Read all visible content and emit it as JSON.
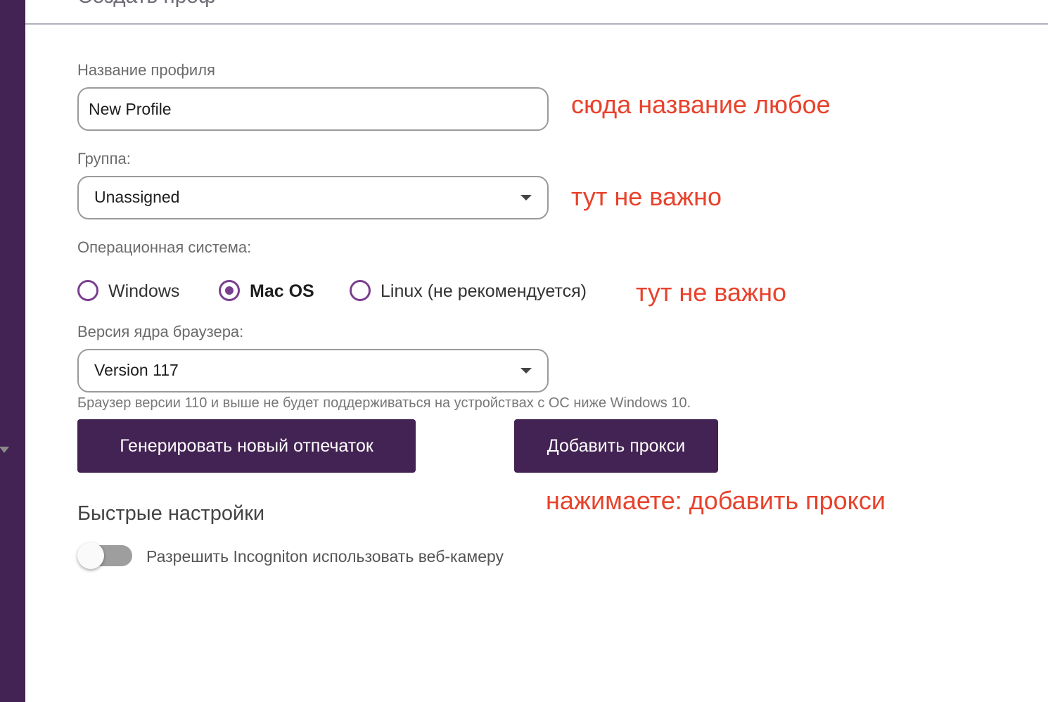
{
  "colors": {
    "sidebar": "#432353",
    "button_bg": "#432353",
    "radio_accent": "#7a3f8e",
    "annotation": "#e8422c"
  },
  "form": {
    "profile_name_label": "Название профиля",
    "profile_name_value": "New Profile",
    "group_label": "Группа:",
    "group_selected": "Unassigned",
    "os_label": "Операционная система:",
    "os_options": [
      {
        "label": "Windows",
        "selected": false
      },
      {
        "label": "Mac OS",
        "selected": true
      },
      {
        "label": "Linux (не рекомендуется)",
        "selected": false
      }
    ],
    "version_label": "Версия ядра браузера:",
    "version_selected": "Version 117",
    "version_hint": "Браузер версии 110 и выше не будет поддерживаться на устройствах с ОС ниже Windows 10."
  },
  "buttons": {
    "generate_fingerprint": "Генерировать новый отпечаток",
    "add_proxy": "Добавить прокси"
  },
  "quick_settings": {
    "title": "Быстрые настройки",
    "webcam_toggle_label": "Разрешить Incogniton использовать веб-камеру",
    "webcam_toggle_on": false
  },
  "annotations": {
    "name_note": "сюда название любое",
    "group_note": "тут не важно",
    "os_note": "тут не важно",
    "proxy_note": "нажимаете: добавить прокси"
  },
  "icons": {
    "sidebar_collapse": "triangle-down-icon",
    "dropdown": "chevron-down-icon"
  }
}
